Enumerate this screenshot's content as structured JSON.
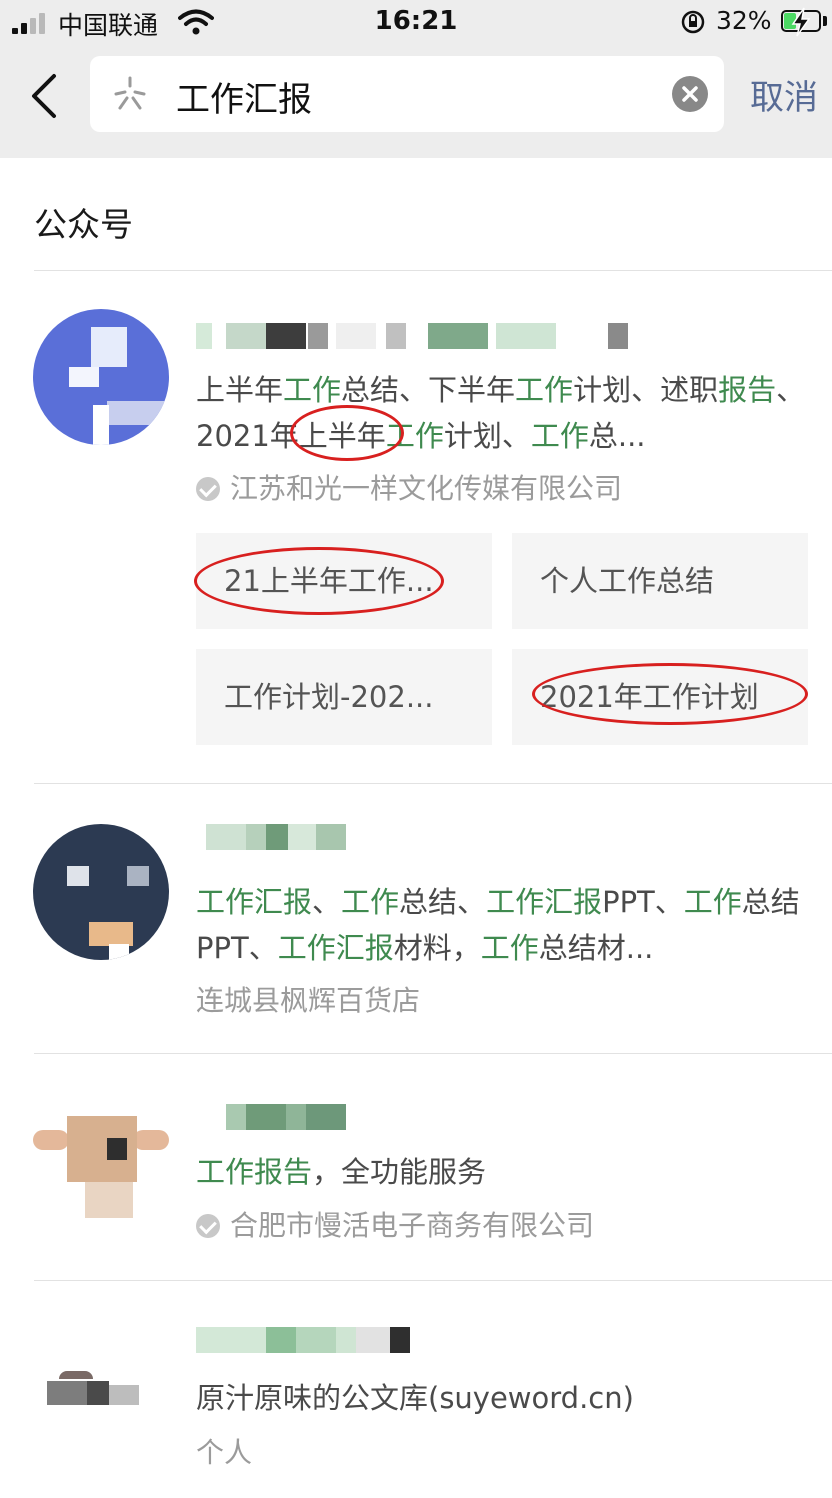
{
  "status_bar": {
    "carrier": "中国联通",
    "time": "16:21",
    "battery_percent": "32%",
    "battery_level": 0.32
  },
  "search": {
    "query": "工作汇报",
    "cancel_label": "取消"
  },
  "section": {
    "title": "公众号"
  },
  "results": [
    {
      "desc_parts": [
        {
          "text": "上半年",
          "hl": false
        },
        {
          "text": "工作",
          "hl": true
        },
        {
          "text": "总结、下半年",
          "hl": false
        },
        {
          "text": "工作",
          "hl": true
        },
        {
          "text": "计划、述职",
          "hl": false
        },
        {
          "text": "报告",
          "hl": true
        },
        {
          "text": "、2021年上半年",
          "hl": false
        },
        {
          "text": "工作",
          "hl": true
        },
        {
          "text": "计划、",
          "hl": false
        },
        {
          "text": "工作",
          "hl": true
        },
        {
          "text": "总...",
          "hl": false
        }
      ],
      "owner": "江苏和光一样文化传媒有限公司",
      "verified": true,
      "tiles": [
        "21上半年工作...",
        "个人工作总结",
        "工作计划-202...",
        "2021年工作计划"
      ]
    },
    {
      "desc_parts": [
        {
          "text": "工作汇报",
          "hl": true
        },
        {
          "text": "、",
          "hl": false
        },
        {
          "text": "工作",
          "hl": true
        },
        {
          "text": "总结、",
          "hl": false
        },
        {
          "text": "工作汇报",
          "hl": true
        },
        {
          "text": "PPT、",
          "hl": false
        },
        {
          "text": "工作",
          "hl": true
        },
        {
          "text": "总结PPT、",
          "hl": false
        },
        {
          "text": "工作汇报",
          "hl": true
        },
        {
          "text": "材料，",
          "hl": false
        },
        {
          "text": "工作",
          "hl": true
        },
        {
          "text": "总结材...",
          "hl": false
        }
      ],
      "owner": "连城县枫辉百货店",
      "verified": false
    },
    {
      "desc_parts": [
        {
          "text": "工作报告",
          "hl": true
        },
        {
          "text": "，全功能服务",
          "hl": false
        }
      ],
      "owner": "合肥市慢活电子商务有限公司",
      "verified": true
    },
    {
      "desc_parts": [
        {
          "text": "原汁原味的公文库(suyeword.cn)",
          "hl": false
        }
      ],
      "owner": "个人",
      "verified": false
    }
  ],
  "colors": {
    "highlight": "#3f8a4f",
    "cancel": "#576b95",
    "annotation": "#d8201f",
    "header_bg": "#ededed"
  }
}
